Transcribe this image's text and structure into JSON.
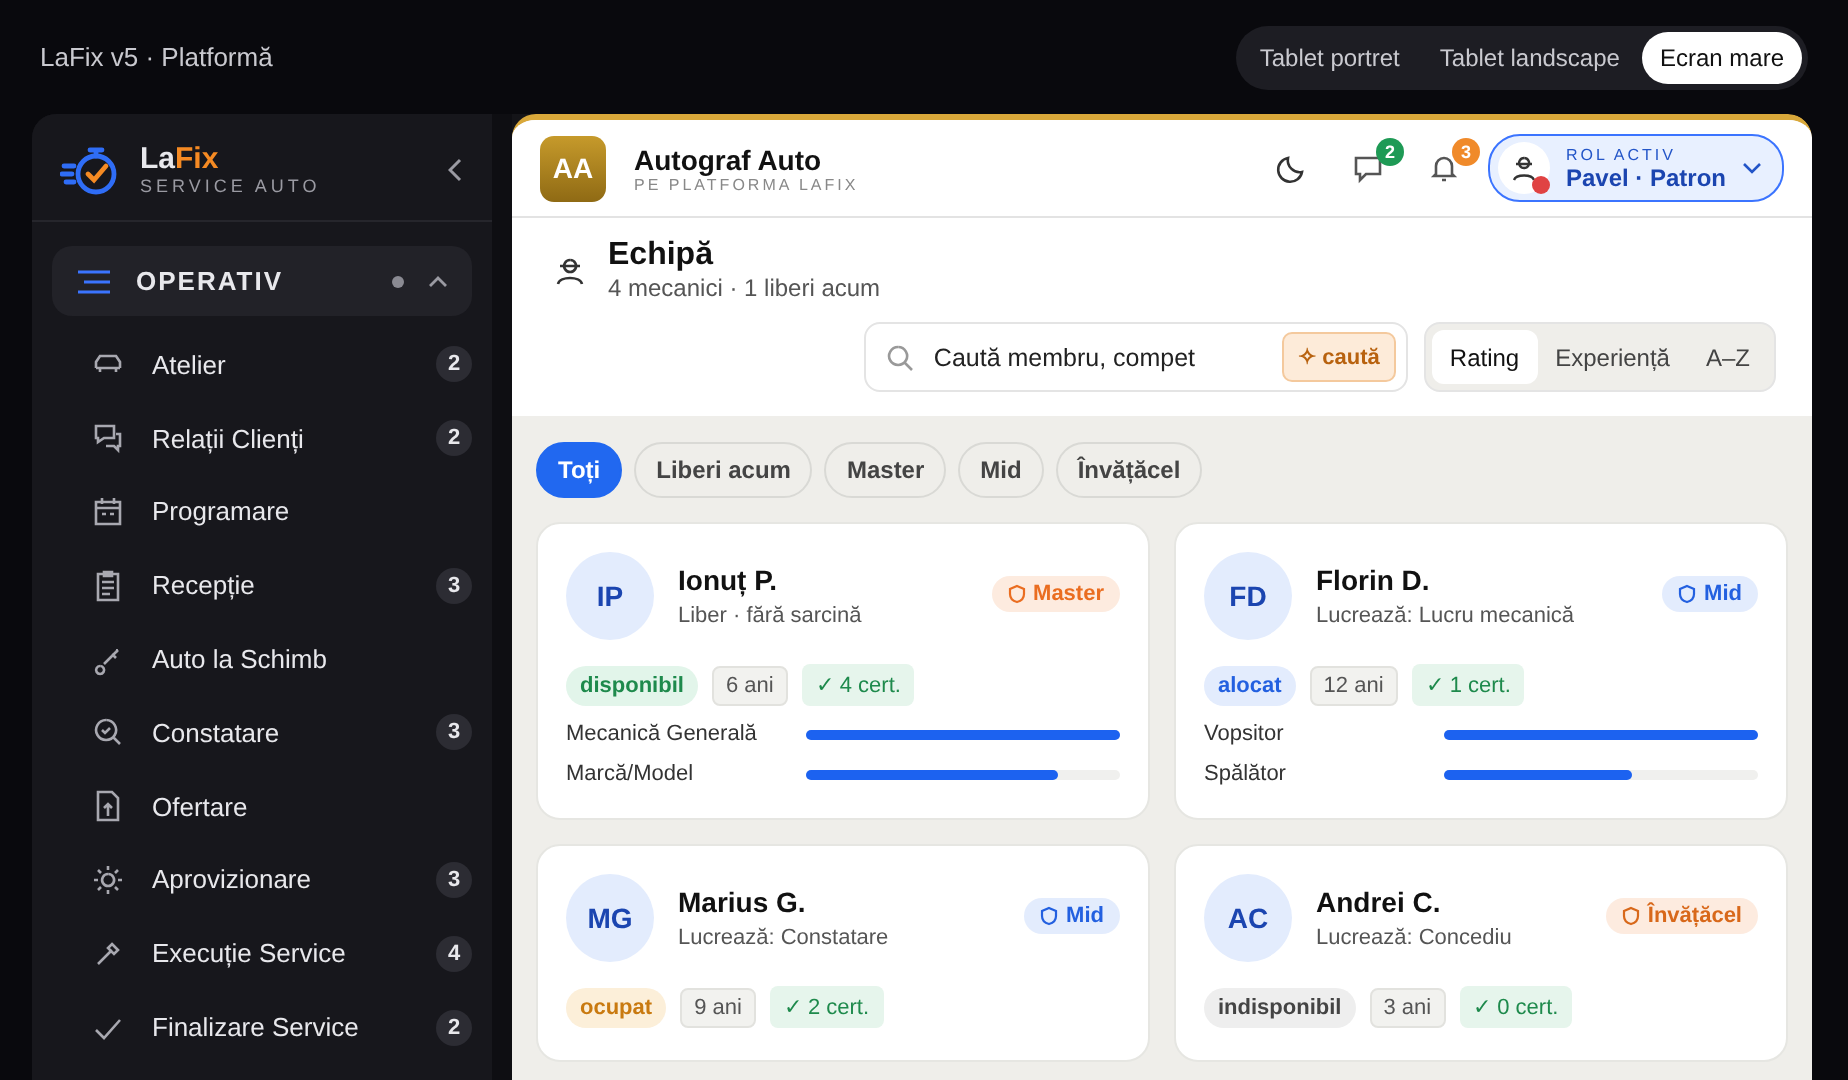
{
  "app_title": "LaFix v5 · Platformă",
  "view_modes": [
    {
      "label": "Tablet portret",
      "selected": false
    },
    {
      "label": "Tablet landscape",
      "selected": false
    },
    {
      "label": "Ecran mare",
      "selected": true
    }
  ],
  "sidebar": {
    "brand": {
      "name_a": "La",
      "name_b": "Fix",
      "tagline": "SERVICE AUTO"
    },
    "section": {
      "label": "OPERATIV",
      "expanded": true
    },
    "items": [
      {
        "label": "Atelier",
        "count": "2"
      },
      {
        "label": "Relații Clienți",
        "count": "2"
      },
      {
        "label": "Programare"
      },
      {
        "label": "Recepție",
        "count": "3"
      },
      {
        "label": "Auto la Schimb"
      },
      {
        "label": "Constatare",
        "count": "3"
      },
      {
        "label": "Ofertare"
      },
      {
        "label": "Aprovizionare",
        "count": "3"
      },
      {
        "label": "Execuție Service",
        "count": "4"
      },
      {
        "label": "Finalizare Service",
        "count": "2"
      }
    ]
  },
  "header": {
    "initials": "AA",
    "company": "Autograf Auto",
    "subtitle": "PE PLATFORMA LAFIX",
    "messages_count": "2",
    "alerts_count": "3",
    "role_label": "ROL ACTIV",
    "role_value": "Pavel · Patron"
  },
  "page": {
    "title": "Echipă",
    "subtitle": "4 mecanici · 1 liberi acum",
    "search": {
      "placeholder": "Caută membru, compet",
      "button": "✧ caută"
    },
    "sort": [
      {
        "label": "Rating",
        "selected": true
      },
      {
        "label": "Experiență",
        "selected": false
      },
      {
        "label": "A–Z",
        "selected": false
      }
    ],
    "filters": [
      {
        "label": "Toți",
        "selected": true
      },
      {
        "label": "Liberi acum",
        "selected": false
      },
      {
        "label": "Master",
        "selected": false
      },
      {
        "label": "Mid",
        "selected": false
      },
      {
        "label": "Învățăcel",
        "selected": false
      }
    ]
  },
  "members": [
    {
      "initials": "IP",
      "name": "Ionuț P.",
      "activity": "Liber · fără sarcină",
      "tier": {
        "label": "Master",
        "kind": "master"
      },
      "status": {
        "label": "disponibil",
        "kind": "free"
      },
      "experience": "6 ani",
      "certs": "✓ 4 cert.",
      "skills": [
        {
          "name": "Mecanică Generală",
          "level": 1.0
        },
        {
          "name": "Marcă/Model",
          "level": 0.8
        }
      ]
    },
    {
      "initials": "FD",
      "name": "Florin D.",
      "activity": "Lucrează: Lucru mecanică",
      "tier": {
        "label": "Mid",
        "kind": "mid"
      },
      "status": {
        "label": "alocat",
        "kind": "assigned"
      },
      "experience": "12 ani",
      "certs": "✓ 1 cert.",
      "skills": [
        {
          "name": "Vopsitor",
          "level": 1.0
        },
        {
          "name": "Spălător",
          "level": 0.6
        }
      ]
    },
    {
      "initials": "MG",
      "name": "Marius G.",
      "activity": "Lucrează: Constatare",
      "tier": {
        "label": "Mid",
        "kind": "mid"
      },
      "status": {
        "label": "ocupat",
        "kind": "busy"
      },
      "experience": "9 ani",
      "certs": "✓ 2 cert."
    },
    {
      "initials": "AC",
      "name": "Andrei C.",
      "activity": "Lucrează: Concediu",
      "tier": {
        "label": "Învățăcel",
        "kind": "apprentice"
      },
      "status": {
        "label": "indisponibil",
        "kind": "off"
      },
      "experience": "3 ani",
      "certs": "✓ 0 cert."
    }
  ]
}
